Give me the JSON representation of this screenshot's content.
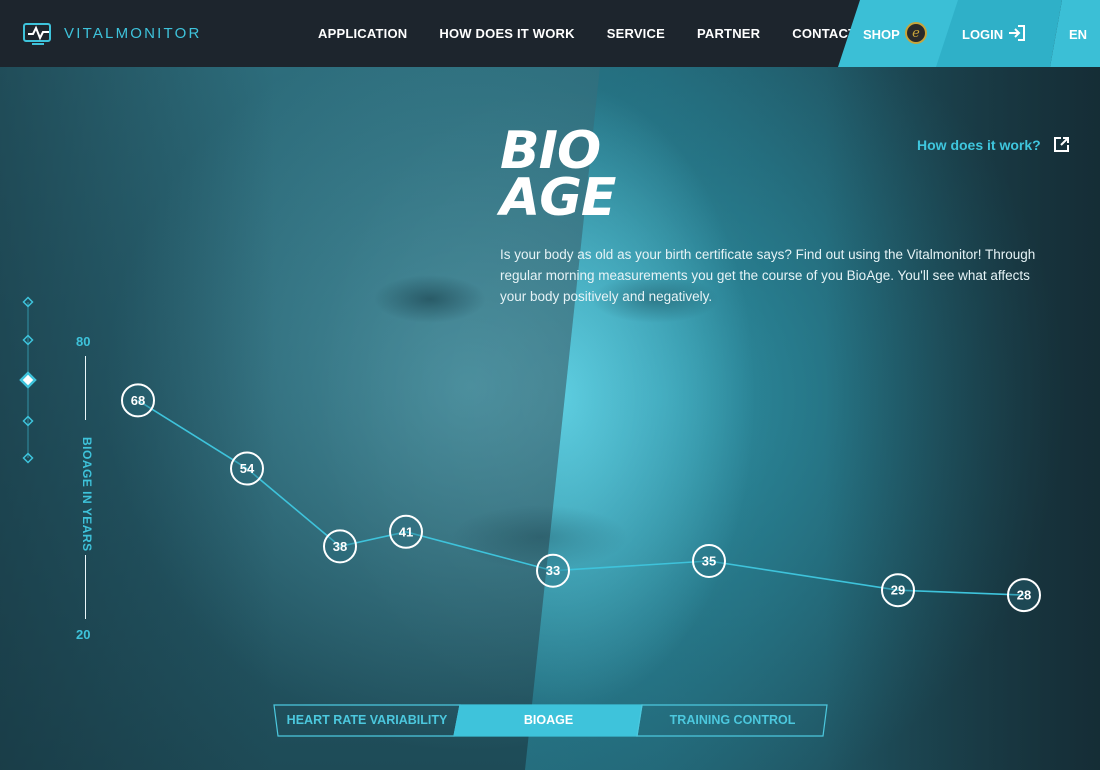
{
  "brand": {
    "name": "VITALMONITOR",
    "accent": "#3ec3db"
  },
  "nav": {
    "items": [
      "APPLICATION",
      "HOW DOES IT WORK",
      "SERVICE",
      "PARTNER",
      "CONTACT"
    ],
    "shop": "SHOP",
    "login": "LOGIN",
    "lang": "EN"
  },
  "hero": {
    "title_line1": "BIO",
    "title_line2": "AGE",
    "intro": "Is your body as old as your birth certificate says? Find out using the Vitalmonitor! Through regular morning measurements you get the course of you BioAge. You'll see what affects your body positively and negatively.",
    "how_link": "How does it work?"
  },
  "side_nav": {
    "count": 5,
    "active_index": 2
  },
  "chart_data": {
    "type": "line",
    "ylabel": "BIOAGE IN YEARS",
    "ylim": [
      20,
      80
    ],
    "y_ticks": [
      "80",
      "20"
    ],
    "values": [
      68,
      54,
      38,
      41,
      33,
      35,
      29,
      28
    ],
    "color": "#3ec3db",
    "grid": false
  },
  "tabs": {
    "items": [
      "HEART RATE VARIABILITY",
      "BIOAGE",
      "TRAINING CONTROL"
    ],
    "active_index": 1
  }
}
